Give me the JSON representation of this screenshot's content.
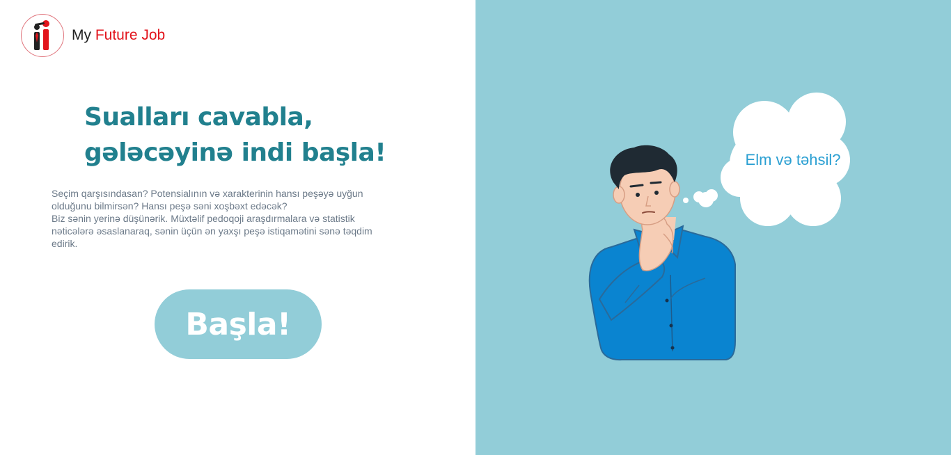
{
  "brand": {
    "name_prefix": "My ",
    "name_accent": "Future Job"
  },
  "colors": {
    "brand_red": "#e2141c",
    "title_teal": "#21808e",
    "panel_bg": "#92cdd8",
    "shirt_blue": "#0a84d0",
    "thought_text": "#2a9fd2"
  },
  "hero": {
    "title_lines": [
      "Sualları cavabla,",
      "gələcəyinə indi başla!"
    ],
    "description_lines": [
      "Seçim qarşısındasan? Potensialının və xarakterinin hansı peşəyə uyğun",
      "olduğunu bilmirsən? Hansı peşə səni xoşbəxt edəcək?",
      "Biz sənin yerinə düşünərik. Müxtəlif pedoqoji araşdırmalara və statistik",
      "nəticələrə əsaslanaraq, sənin üçün ən yaxşı peşə istiqamətini sənə təqdim",
      "edirik."
    ],
    "start_button_label": "Başla!"
  },
  "illustration": {
    "thought_bubble_text": "Elm və təhsil?",
    "icon": "thinking-person-illustration"
  }
}
